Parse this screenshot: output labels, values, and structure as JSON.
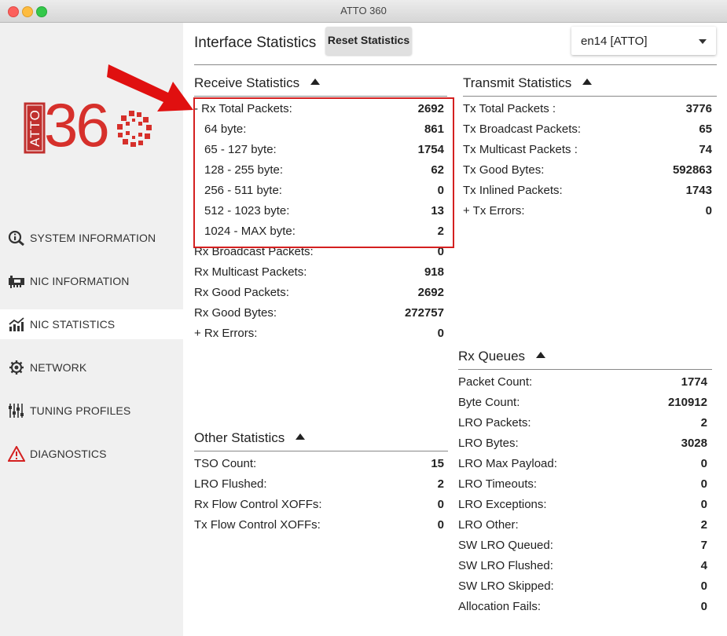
{
  "window": {
    "title": "ATTO 360"
  },
  "logo": {
    "box_text": "ATTO",
    "number_text": "360"
  },
  "sidebar": {
    "items": [
      {
        "label": "SYSTEM INFORMATION",
        "icon": "info-magnifier-icon",
        "active": false
      },
      {
        "label": "NIC INFORMATION",
        "icon": "network-card-icon",
        "active": false
      },
      {
        "label": "NIC STATISTICS",
        "icon": "statistics-chart-icon",
        "active": true
      },
      {
        "label": "NETWORK",
        "icon": "network-gear-icon",
        "active": false
      },
      {
        "label": "TUNING PROFILES",
        "icon": "sliders-icon",
        "active": false
      },
      {
        "label": "DIAGNOSTICS",
        "icon": "warning-triangle-icon",
        "active": false
      }
    ]
  },
  "header": {
    "title": "Interface Statistics",
    "reset_label": "Reset Statistics",
    "interface_select": "en14 [ATTO]"
  },
  "receive": {
    "title": "Receive Statistics",
    "rows": [
      {
        "label": "- Rx Total Packets:",
        "value": "2692"
      },
      {
        "label": "64 byte:",
        "value": "861"
      },
      {
        "label": "65 - 127 byte:",
        "value": "1754"
      },
      {
        "label": "128 - 255 byte:",
        "value": "62"
      },
      {
        "label": "256 - 511 byte:",
        "value": "0"
      },
      {
        "label": "512 - 1023 byte:",
        "value": "13"
      },
      {
        "label": "1024 - MAX byte:",
        "value": "2"
      },
      {
        "label": "Rx Broadcast Packets:",
        "value": "0"
      },
      {
        "label": "Rx Multicast Packets:",
        "value": "918"
      },
      {
        "label": "Rx Good Packets:",
        "value": "2692"
      },
      {
        "label": "Rx Good Bytes:",
        "value": "272757"
      },
      {
        "label": "+ Rx Errors:",
        "value": "0"
      }
    ]
  },
  "transmit": {
    "title": "Transmit Statistics",
    "rows": [
      {
        "label": "Tx Total Packets :",
        "value": "3776"
      },
      {
        "label": "Tx Broadcast Packets:",
        "value": "65"
      },
      {
        "label": "Tx Multicast Packets :",
        "value": "74"
      },
      {
        "label": "Tx Good Bytes:",
        "value": "592863"
      },
      {
        "label": "Tx Inlined Packets:",
        "value": "1743"
      },
      {
        "label": "+ Tx Errors:",
        "value": "0"
      }
    ]
  },
  "rx_queues": {
    "title": "Rx Queues",
    "rows": [
      {
        "label": "Packet Count:",
        "value": "1774"
      },
      {
        "label": "Byte Count:",
        "value": "210912"
      },
      {
        "label": "LRO Packets:",
        "value": "2"
      },
      {
        "label": "LRO Bytes:",
        "value": "3028"
      },
      {
        "label": "LRO Max Payload:",
        "value": "0"
      },
      {
        "label": "LRO Timeouts:",
        "value": "0"
      },
      {
        "label": "LRO Exceptions:",
        "value": "0"
      },
      {
        "label": "LRO Other:",
        "value": "2"
      },
      {
        "label": "SW LRO Queued:",
        "value": "7"
      },
      {
        "label": "SW LRO Flushed:",
        "value": "4"
      },
      {
        "label": "SW LRO Skipped:",
        "value": "0"
      },
      {
        "label": "Allocation Fails:",
        "value": "0"
      }
    ]
  },
  "other": {
    "title": "Other Statistics",
    "rows": [
      {
        "label": "TSO Count:",
        "value": "15"
      },
      {
        "label": "LRO Flushed:",
        "value": "2"
      },
      {
        "label": "Rx Flow Control XOFFs:",
        "value": "0"
      },
      {
        "label": "Tx Flow Control XOFFs:",
        "value": "0"
      }
    ]
  },
  "colors": {
    "brand_red": "#d6302b",
    "highlight_border": "#d42020",
    "arrow": "#e01010",
    "sidebar_bg": "#f0f0f0"
  }
}
